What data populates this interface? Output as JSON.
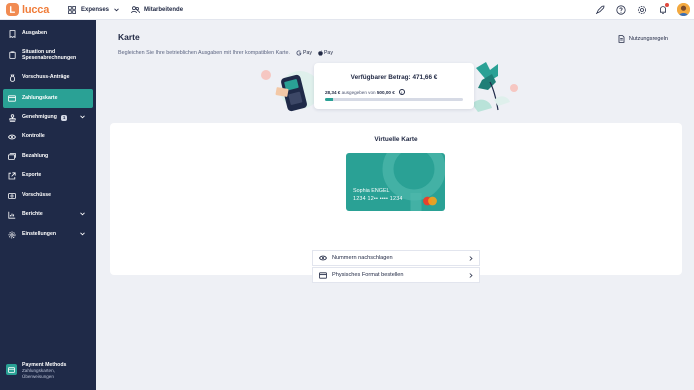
{
  "topbar": {
    "logo_text": "lucca",
    "app_name": "Expenses",
    "people_label": "Mitarbeitende"
  },
  "sidebar": {
    "items": [
      {
        "label": "Ausgaben",
        "icon": "receipt-icon"
      },
      {
        "label": "Situation und Spesenabrechnungen",
        "icon": "clipboard-icon"
      },
      {
        "label": "Vorschuss-Anträge",
        "icon": "coin-bag-icon"
      },
      {
        "label": "Zahlungskarte",
        "icon": "credit-card-icon",
        "active": true
      },
      {
        "label": "Genehmigung",
        "icon": "stamp-icon",
        "badge": "1",
        "chevron": true
      },
      {
        "label": "Kontrolle",
        "icon": "eye-icon"
      },
      {
        "label": "Bezahlung",
        "icon": "card-stack-icon"
      },
      {
        "label": "Exporte",
        "icon": "export-icon"
      },
      {
        "label": "Vorschüsse",
        "icon": "money-icon"
      },
      {
        "label": "Berichte",
        "icon": "chart-icon",
        "chevron": true
      },
      {
        "label": "Einstellungen",
        "icon": "gear-icon",
        "chevron": true
      }
    ],
    "footer": {
      "title": "Payment Methods",
      "subtitle": "Zahlungskarten, Überweisungen"
    }
  },
  "page": {
    "title": "Karte",
    "subtitle": "Begleichen Sie Ihre betrieblichen Ausgaben mit Ihrer kompatiblen Karte.",
    "gpay": "Pay",
    "apple_pay": "Pay",
    "terms_label": "Nutzungsregeln"
  },
  "balance": {
    "title": "Verfügbarer Betrag: 471,66 €",
    "spent": "28,34 €",
    "spent_of": "ausgegeben von",
    "limit": "500,00 €",
    "progress_fraction": 0.057
  },
  "virtual_card": {
    "section_title": "Virtuelle Karte",
    "holder": "Sophia ENGEL",
    "number": "1234 12•• •••• 1234",
    "color": "#2aa195"
  },
  "actions": [
    {
      "label": "Nummern nachschlagen",
      "icon": "eye-icon"
    },
    {
      "label": "Physisches Format bestellen",
      "icon": "card-icon"
    }
  ],
  "colors": {
    "sidebar": "#1f2a48",
    "accent": "#2aa195",
    "brand": "#f07d3b"
  }
}
